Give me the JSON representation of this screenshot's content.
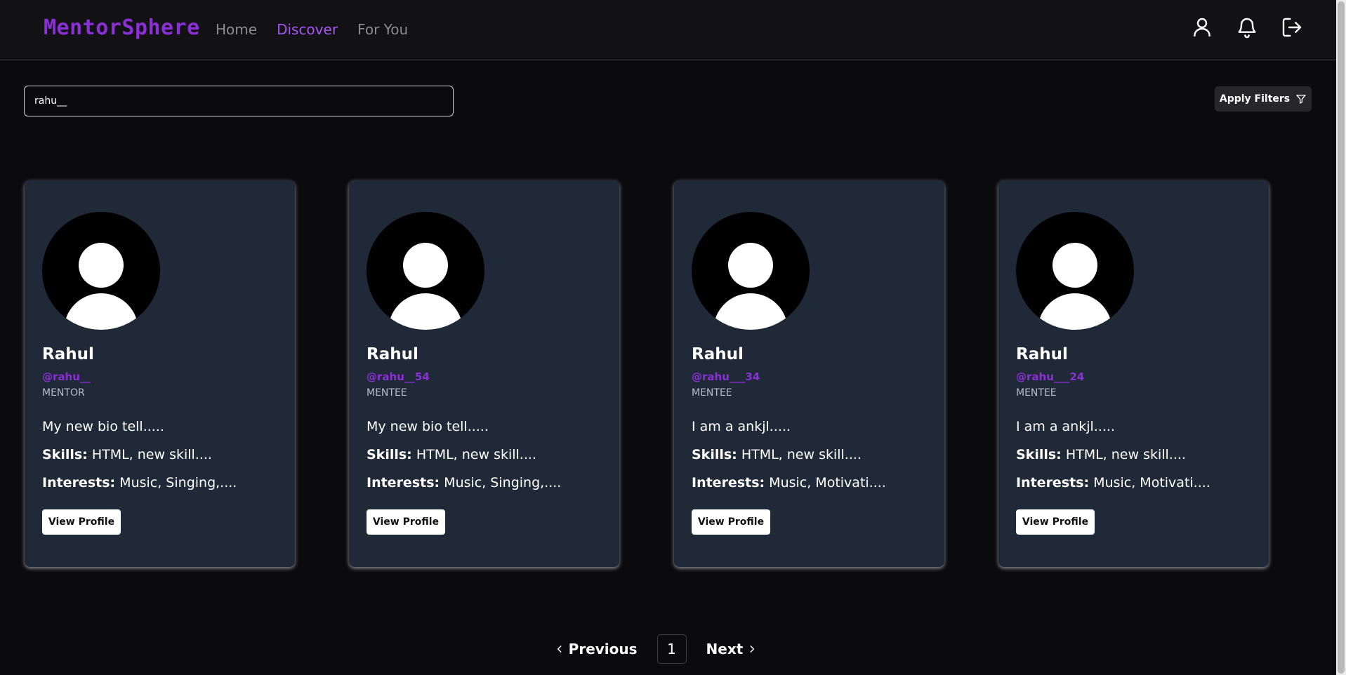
{
  "navbar": {
    "logo": "MentorSphere",
    "links": [
      {
        "label": "Home",
        "active": false
      },
      {
        "label": "Discover",
        "active": true
      },
      {
        "label": "For You",
        "active": false
      }
    ],
    "icons": [
      "user-icon",
      "bell-icon",
      "logout-icon"
    ]
  },
  "search": {
    "value": "rahu__"
  },
  "filters": {
    "label": "Apply Filters",
    "icon": "filter-icon"
  },
  "colors": {
    "accent": "#8b2fd6",
    "card_bg": "#1f2937",
    "page_bg": "#0b0b0e"
  },
  "cards": [
    {
      "name": "Rahul",
      "handle": "@rahu__",
      "role": "MENTOR",
      "bio": "My new bio tell.....",
      "skills_label": "Skills:",
      "skills": "HTML, new skill....",
      "interests_label": "Interests:",
      "interests": "Music, Singing,....",
      "button": "View Profile"
    },
    {
      "name": "Rahul",
      "handle": "@rahu__54",
      "role": "MENTEE",
      "bio": "My new bio tell.....",
      "skills_label": "Skills:",
      "skills": "HTML, new skill....",
      "interests_label": "Interests:",
      "interests": "Music, Singing,....",
      "button": "View Profile"
    },
    {
      "name": "Rahul",
      "handle": "@rahu___34",
      "role": "MENTEE",
      "bio": "I am a ankjl.....",
      "skills_label": "Skills:",
      "skills": "HTML, new skill....",
      "interests_label": "Interests:",
      "interests": "Music, Motivati....",
      "button": "View Profile"
    },
    {
      "name": "Rahul",
      "handle": "@rahu___24",
      "role": "MENTEE",
      "bio": "I am a ankjl.....",
      "skills_label": "Skills:",
      "skills": "HTML, new skill....",
      "interests_label": "Interests:",
      "interests": "Music, Motivati....",
      "button": "View Profile"
    }
  ],
  "pagination": {
    "previous": "Previous",
    "current": "1",
    "next": "Next"
  }
}
